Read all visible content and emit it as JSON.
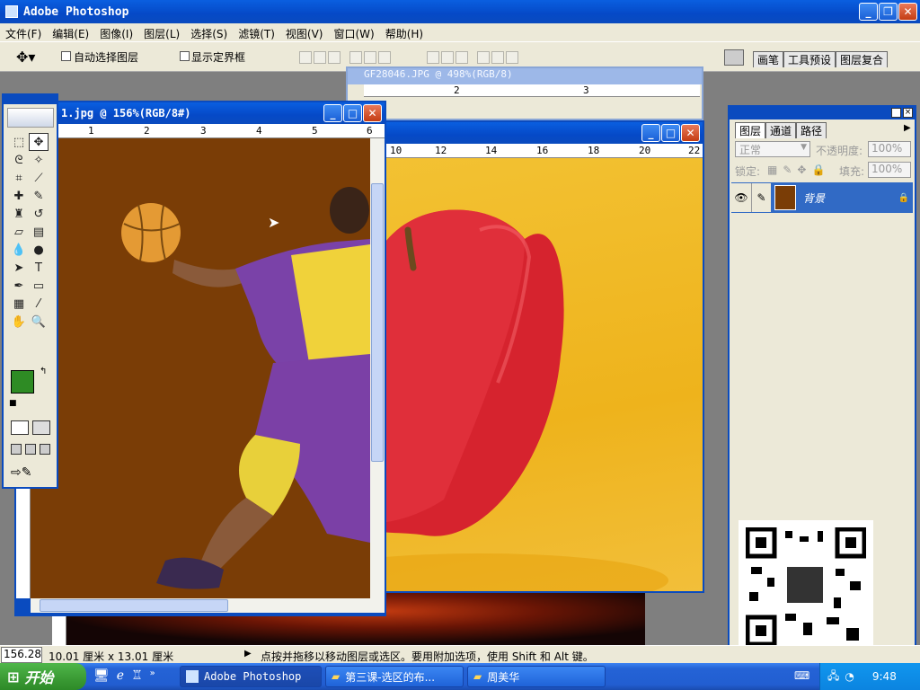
{
  "app": {
    "title": "Adobe Photoshop"
  },
  "menu": [
    "文件(F)",
    "编辑(E)",
    "图像(I)",
    "图层(L)",
    "选择(S)",
    "滤镜(T)",
    "视图(V)",
    "窗口(W)",
    "帮助(H)"
  ],
  "options_bar": {
    "auto_select_label": "自动选择图层",
    "show_bounds_label": "显示定界框",
    "palette_tabs": [
      "画笔",
      "工具预设",
      "图层复合"
    ]
  },
  "doc_back": {
    "title": "GF28046.JPG @ 498%(RGB/8)",
    "ruler_ticks": [
      "2",
      "3"
    ]
  },
  "doc_apple": {
    "ruler_ticks": [
      "10",
      "12",
      "14",
      "16",
      "18",
      "20",
      "22"
    ]
  },
  "doc_front": {
    "title": "1.jpg @ 156%(RGB/8#)",
    "ruler_ticks": [
      "1",
      "2",
      "3",
      "4",
      "5",
      "6"
    ]
  },
  "layers_panel": {
    "tabs": [
      "图层",
      "通道",
      "路径"
    ],
    "blend_mode": "正常",
    "opacity_label": "不透明度:",
    "opacity_value": "100%",
    "lock_label": "锁定:",
    "fill_label": "填充:",
    "fill_value": "100%",
    "layer_name": "背景"
  },
  "status_bar": {
    "zoom": "156.28%",
    "doc_size": "10.01 厘米 x 13.01 厘米",
    "hint": "点按并拖移以移动图层或选区。要用附加选项，使用 Shift 和 Alt 键。"
  },
  "taskbar": {
    "start_label": "开始",
    "windows": [
      "Adobe Photoshop",
      "第三课-选区的布...",
      "周美华"
    ],
    "clock": "9:48"
  },
  "colors": {
    "foreground": "#2e8b24",
    "background": "#ffffff",
    "canvas_front": "#7a3d06",
    "apple_bg": "#f0b520",
    "accent": "#0a5fe0"
  }
}
